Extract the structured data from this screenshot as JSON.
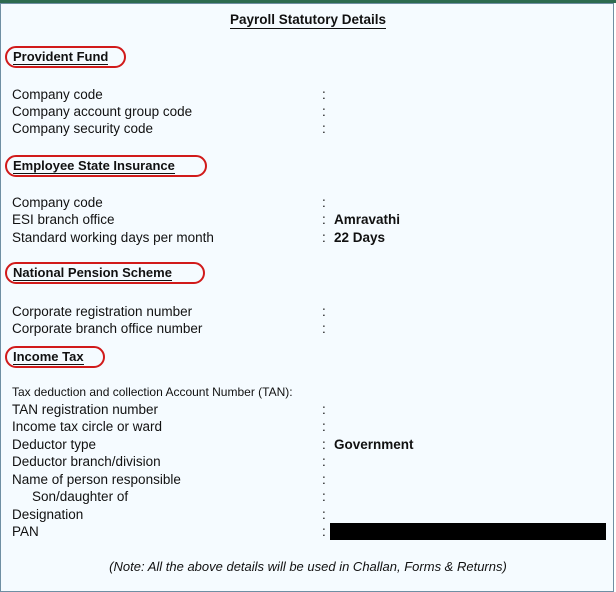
{
  "title": "Payroll Statutory Details",
  "provident_fund": {
    "heading": "Provident Fund",
    "rows": [
      {
        "label": "Company code",
        "colon": ":",
        "value": ""
      },
      {
        "label": "Company account group code",
        "colon": ":",
        "value": ""
      },
      {
        "label": "Company security code",
        "colon": ":",
        "value": ""
      }
    ]
  },
  "esi": {
    "heading": "Employee State Insurance",
    "rows": [
      {
        "label": "Company code",
        "colon": ":",
        "value": ""
      },
      {
        "label": "ESI branch office",
        "colon": ":",
        "value": "Amravathi"
      },
      {
        "label": "Standard working days per month",
        "colon": ":",
        "value": "22 Days"
      }
    ]
  },
  "nps": {
    "heading": "National Pension Scheme",
    "rows": [
      {
        "label": "Corporate registration number",
        "colon": ":",
        "value": ""
      },
      {
        "label": "Corporate branch office number",
        "colon": ":",
        "value": ""
      }
    ]
  },
  "income_tax": {
    "heading": "Income Tax",
    "rows": [
      {
        "label": "Tax deduction and collection Account Number (TAN):",
        "colon": "",
        "value": ""
      },
      {
        "label": "TAN registration number",
        "colon": ":",
        "value": ""
      },
      {
        "label": "Income tax circle or ward",
        "colon": ":",
        "value": ""
      },
      {
        "label": "Deductor type",
        "colon": ":",
        "value": "Government"
      },
      {
        "label": "Deductor branch/division",
        "colon": ":",
        "value": ""
      },
      {
        "label": "Name of person responsible",
        "colon": ":",
        "value": ""
      },
      {
        "label": "Son/daughter of",
        "colon": ":",
        "value": ""
      },
      {
        "label": "Designation",
        "colon": ":",
        "value": ""
      },
      {
        "label": "PAN",
        "colon": ":",
        "value": ""
      }
    ]
  },
  "note": "(Note: All the above details will be used in Challan, Forms & Returns)",
  "colors": {
    "accent_bar": "#2d6b4f",
    "highlight_outline": "#d11a1a",
    "panel_bg": "#f5fbff"
  }
}
